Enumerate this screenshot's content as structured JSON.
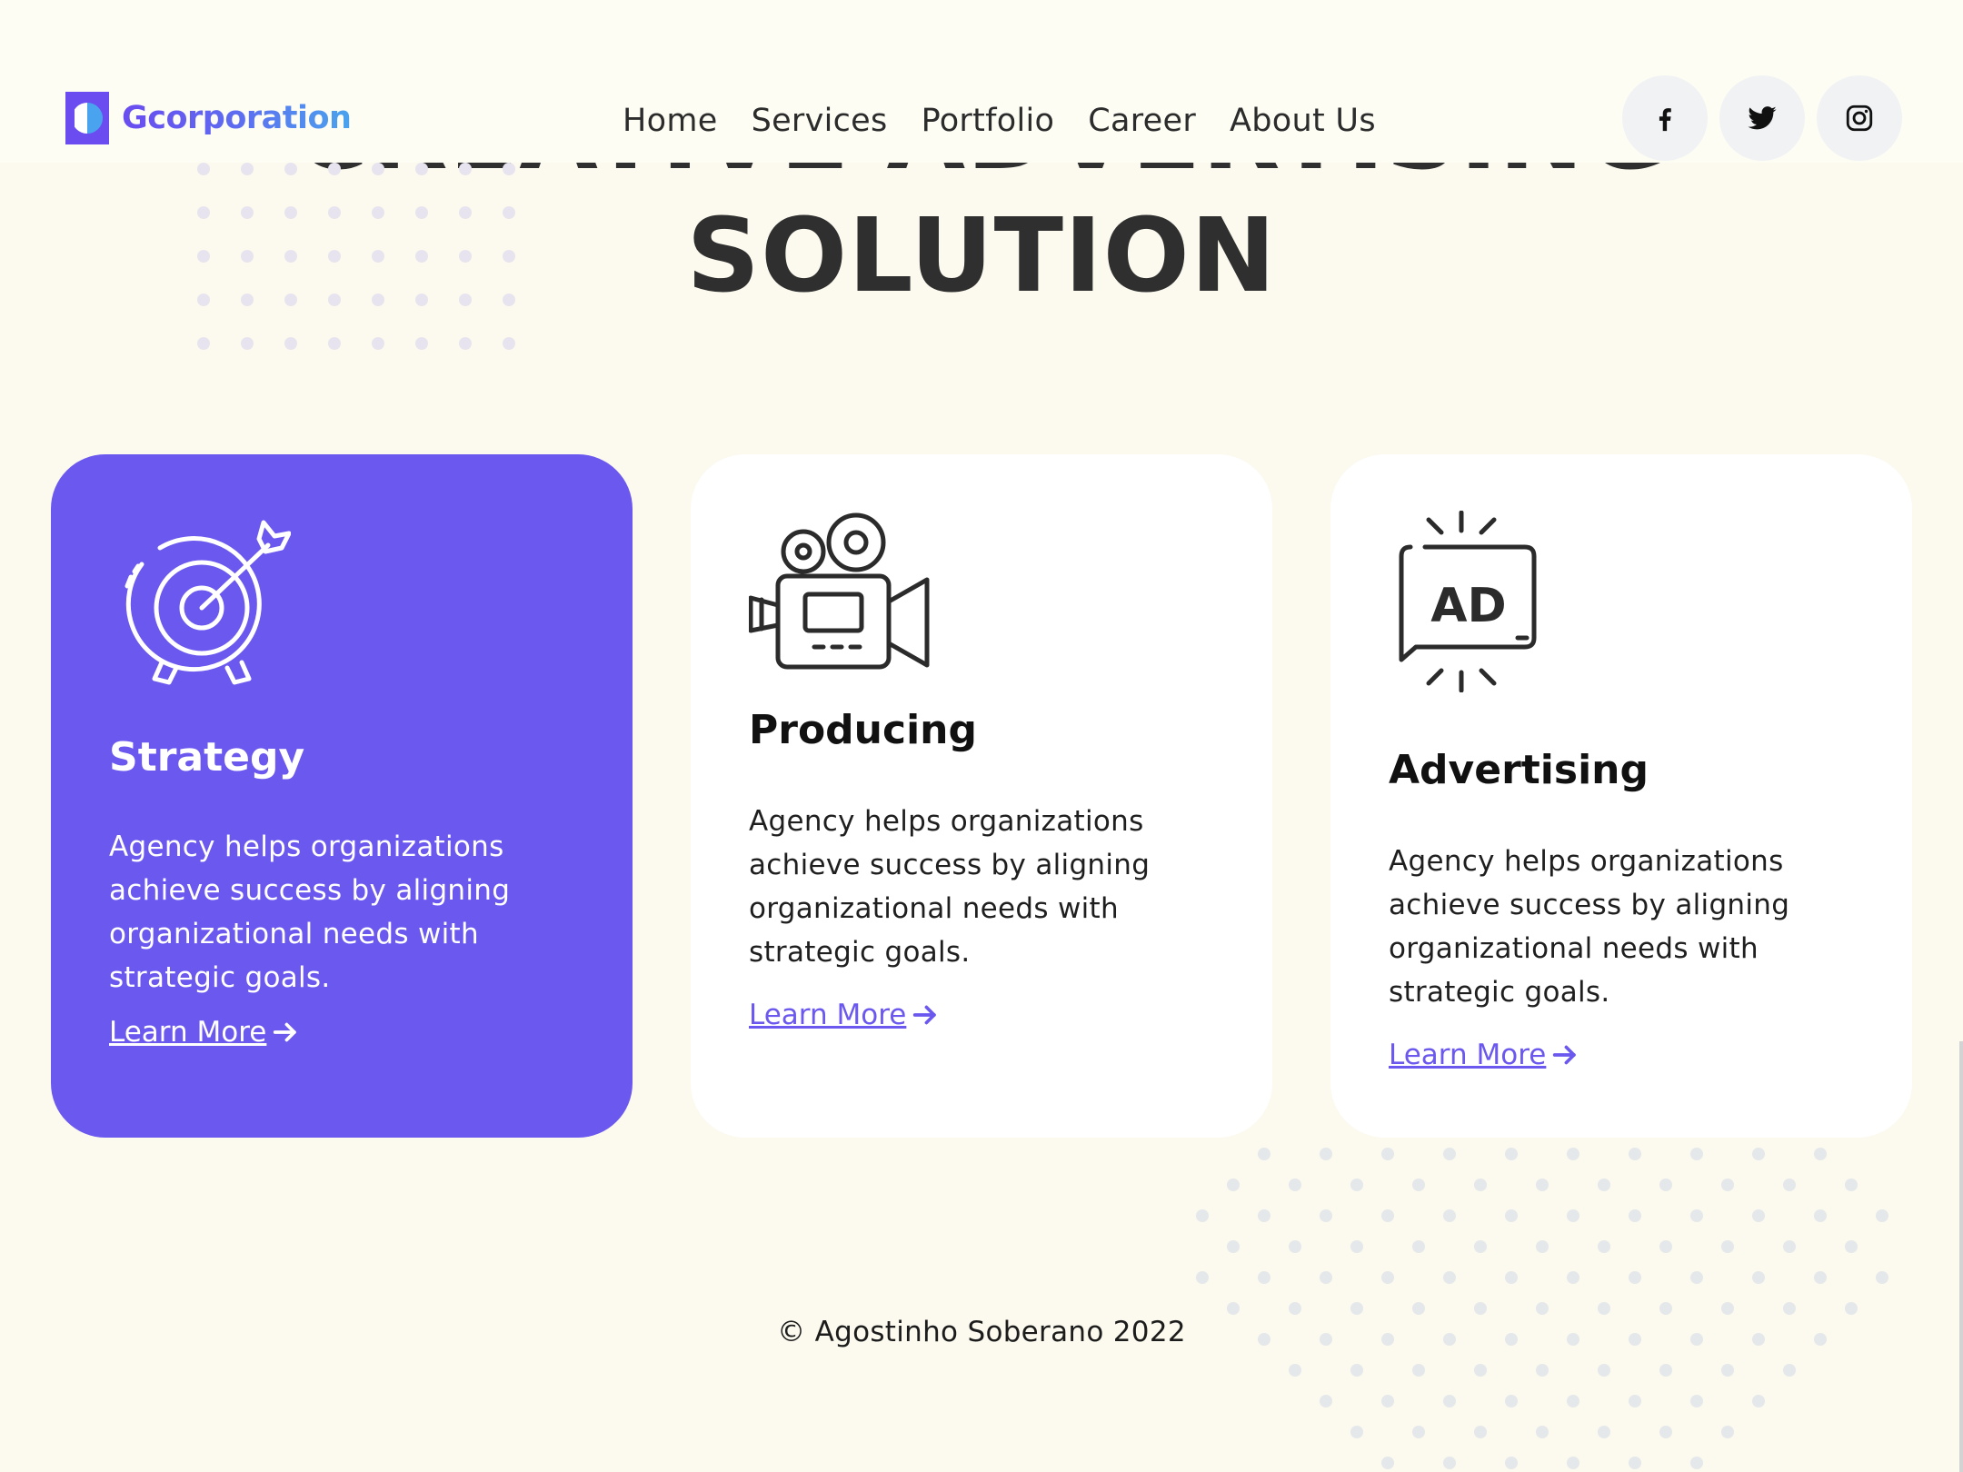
{
  "header": {
    "logo_text": "Gcorporation",
    "nav": [
      "Home",
      "Services",
      "Portfolio",
      "Career",
      "About Us"
    ],
    "socials": [
      "facebook-icon",
      "twitter-icon",
      "instagram-icon"
    ]
  },
  "hero": {
    "line1": "CREATIVE ADVERTISING",
    "line2": "SOLUTION"
  },
  "cards": [
    {
      "icon": "target-arrow-icon",
      "title": "Strategy",
      "text": "Agency helps organizations achieve success by aligning organizational needs with strategic goals.",
      "link": "Learn More"
    },
    {
      "icon": "video-camera-icon",
      "title": "Producing",
      "text": "Agency helps organizations achieve success by aligning organizational needs with strategic goals.",
      "link": "Learn More"
    },
    {
      "icon": "ad-speech-bubble-icon",
      "title": "Advertising",
      "text": "Agency helps organizations achieve success by aligning organizational needs with strategic goals.",
      "link": "Learn More"
    }
  ],
  "footer": {
    "copyright": "© Agostinho Soberano 2022"
  },
  "colors": {
    "accent": "#6b58ef",
    "background": "#fcfaee",
    "card": "#ffffff"
  }
}
